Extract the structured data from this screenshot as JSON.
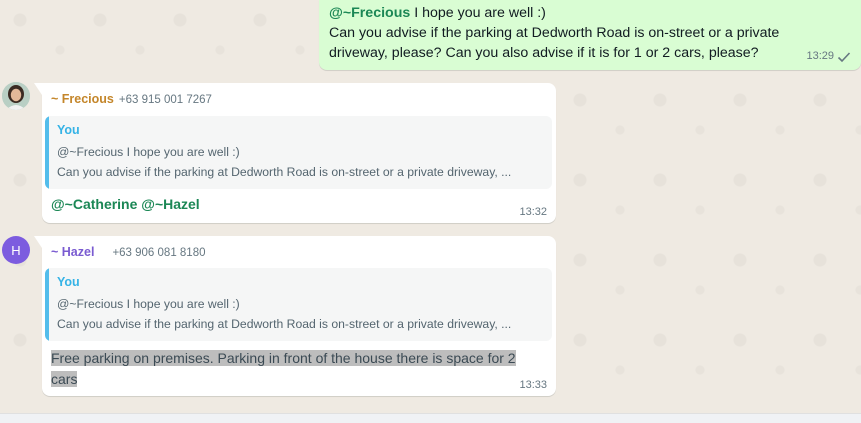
{
  "outgoing": {
    "mention": "@~Frecious",
    "line1_rest": " I hope you are well :)",
    "line2": "Can you advise if the parking at Dedworth Road is on-street or a private",
    "line3": "driveway, please? Can you also advise if it is for 1 or 2 cars, please?",
    "time": "13:29",
    "status_icon": "single-check-icon"
  },
  "messages": [
    {
      "sender": "~ Frecious",
      "phone": "+63 915 001 7267",
      "avatar": "profile-photo",
      "quote": {
        "author": "You",
        "line1": "@~Frecious I hope you are well :)",
        "line2": "Can you advise if the parking at Dedworth Road is on-street or a private driveway, ..."
      },
      "text": "@~Catherine @~Hazel",
      "time": "13:32"
    },
    {
      "sender": "~ Hazel",
      "phone": "+63 906 081 8180",
      "avatar_letter": "H",
      "quote": {
        "author": "You",
        "line1": "@~Frecious I hope you are well :)",
        "line2": "Can you advise if the parking at Dedworth Road is on-street or a private driveway, ..."
      },
      "text_line1": "Free parking on premises. Parking in front of the house there is space for 2",
      "text_line2": "cars",
      "time": "13:33"
    }
  ],
  "colors": {
    "outgoing_bubble": "#d9fdd3",
    "incoming_bubble": "#ffffff",
    "mention": "#1b8755",
    "quote_bar": "#53bdeb",
    "frecious_name": "#c4862a",
    "hazel_name": "#7a5bd1"
  }
}
